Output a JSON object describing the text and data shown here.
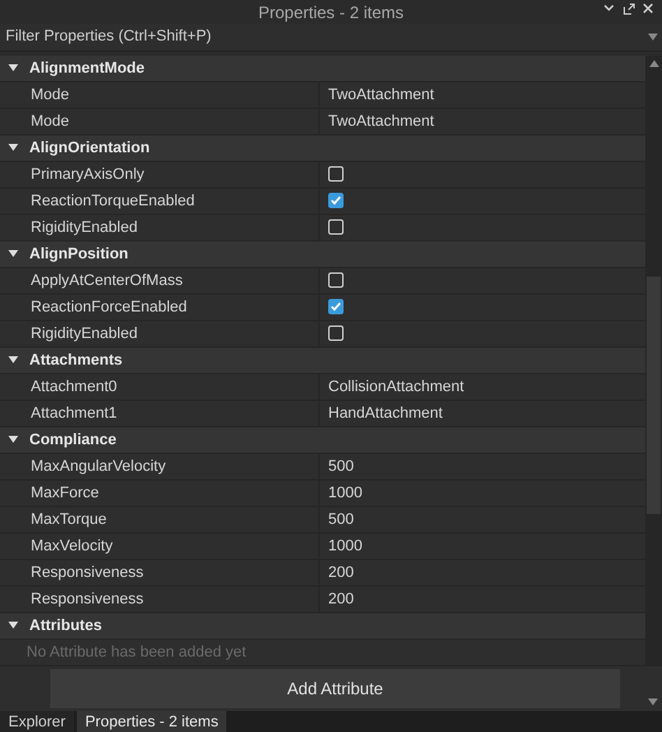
{
  "window": {
    "title": "Properties - 2 items"
  },
  "filter": {
    "placeholder": "Filter Properties (Ctrl+Shift+P)"
  },
  "sections": [
    {
      "title": "AlignmentMode",
      "expanded": true,
      "rows": [
        {
          "kind": "text",
          "name": "Mode",
          "value": "TwoAttachment"
        },
        {
          "kind": "text",
          "name": "Mode",
          "value": "TwoAttachment"
        }
      ]
    },
    {
      "title": "AlignOrientation",
      "expanded": true,
      "rows": [
        {
          "kind": "checkbox",
          "name": "PrimaryAxisOnly",
          "checked": false
        },
        {
          "kind": "checkbox",
          "name": "ReactionTorqueEnabled",
          "checked": true
        },
        {
          "kind": "checkbox",
          "name": "RigidityEnabled",
          "checked": false
        }
      ]
    },
    {
      "title": "AlignPosition",
      "expanded": true,
      "rows": [
        {
          "kind": "checkbox",
          "name": "ApplyAtCenterOfMass",
          "checked": false
        },
        {
          "kind": "checkbox",
          "name": "ReactionForceEnabled",
          "checked": true
        },
        {
          "kind": "checkbox",
          "name": "RigidityEnabled",
          "checked": false
        }
      ]
    },
    {
      "title": "Attachments",
      "expanded": true,
      "rows": [
        {
          "kind": "text",
          "name": "Attachment0",
          "value": "CollisionAttachment"
        },
        {
          "kind": "text",
          "name": "Attachment1",
          "value": "HandAttachment"
        }
      ]
    },
    {
      "title": "Compliance",
      "expanded": true,
      "rows": [
        {
          "kind": "text",
          "name": "MaxAngularVelocity",
          "value": "500"
        },
        {
          "kind": "text",
          "name": "MaxForce",
          "value": "1000"
        },
        {
          "kind": "text",
          "name": "MaxTorque",
          "value": "500"
        },
        {
          "kind": "text",
          "name": "MaxVelocity",
          "value": "1000"
        },
        {
          "kind": "text",
          "name": "Responsiveness",
          "value": "200"
        },
        {
          "kind": "text",
          "name": "Responsiveness",
          "value": "200"
        }
      ]
    },
    {
      "title": "Attributes",
      "expanded": true,
      "rows": [
        {
          "kind": "note",
          "text": "No Attribute has been added yet"
        }
      ]
    }
  ],
  "add_button": "Add Attribute",
  "tabs": [
    {
      "label": "Explorer",
      "selected": false
    },
    {
      "label": "Properties - 2 items",
      "selected": true
    }
  ]
}
